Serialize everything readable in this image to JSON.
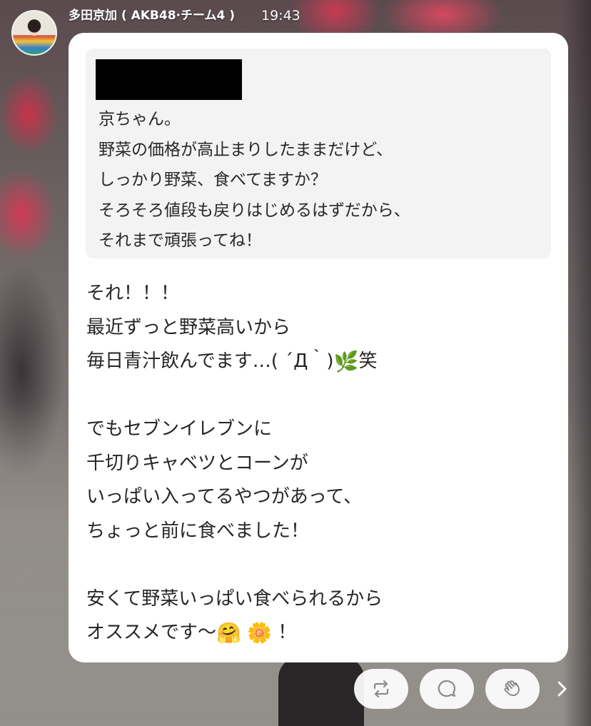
{
  "header": {
    "sender": "多田京加 ( AKB48·チーム4 )",
    "time": "19:43"
  },
  "quote": {
    "lines": [
      "京ちゃん。",
      "野菜の価格が高止まりしたままだけど、",
      "しっかり野菜、食べてますか？",
      "そろそろ値段も戻りはじめるはずだから、",
      "それまで頑張ってね！"
    ]
  },
  "message": {
    "line1": "それ！！！",
    "line2": "最近ずっと野菜高いから",
    "line3_text": "毎日青汁飲んでます…( ´Д｀)",
    "line3_emoji": "🌿",
    "line3_suffix": "笑",
    "line4": "でもセブンイレブンに",
    "line5": "千切りキャベツとコーンが",
    "line6": "いっぱい入ってるやつがあって、",
    "line7": "ちょっと前に食べました！",
    "line8": "安くて野菜いっぱい食べられるから",
    "line9_text": "オススメです〜",
    "line9_emoji1": "🤗",
    "line9_emoji2": "🌼",
    "line9_suffix": "！"
  },
  "actions": {
    "repost_icon": "repost-icon",
    "comment_icon": "comment-icon",
    "clap_icon": "clap-icon",
    "next_icon": "chevron-right-icon"
  },
  "colors": {
    "bubble": "#ffffff",
    "quote_bg": "#f3f3f3",
    "text": "#262626",
    "icon": "#8a8a8a"
  }
}
